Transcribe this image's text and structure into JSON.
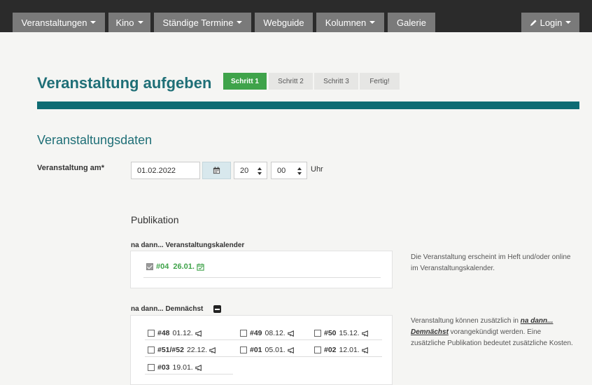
{
  "nav": {
    "items": [
      {
        "label": "Veranstaltungen",
        "dropdown": true
      },
      {
        "label": "Kino",
        "dropdown": true
      },
      {
        "label": "Ständige Termine",
        "dropdown": true
      },
      {
        "label": "Webguide",
        "dropdown": false
      },
      {
        "label": "Kolumnen",
        "dropdown": true
      },
      {
        "label": "Galerie",
        "dropdown": false
      }
    ],
    "login": {
      "label": "Login",
      "icon": "pencil-icon"
    }
  },
  "page": {
    "title": "Veranstaltung aufgeben",
    "steps": [
      {
        "label": "Schritt 1",
        "active": true
      },
      {
        "label": "Schritt 2",
        "active": false
      },
      {
        "label": "Schritt 3",
        "active": false
      },
      {
        "label": "Fertig!",
        "active": false
      }
    ],
    "accent_color": "#0f6c73",
    "active_step_color": "#3fa34a"
  },
  "form": {
    "section_title": "Veranstaltungsdaten",
    "date_label": "Veranstaltung am*",
    "date_value": "01.02.2022",
    "hour_value": "20",
    "minute_value": "00",
    "time_suffix": "Uhr"
  },
  "publication": {
    "title": "Publikation",
    "kalender": {
      "title": "na dann... Veranstaltungskalender",
      "item": {
        "num": "#04",
        "date": "26.01.",
        "checked": true
      },
      "help": "Die Veranstaltung erscheint im Heft und/oder online im Veranstaltungskalender."
    },
    "demnaechst": {
      "title": "na dann... Demnächst",
      "items": [
        {
          "num": "#48",
          "date": "01.12.",
          "checked": false
        },
        {
          "num": "#49",
          "date": "08.12.",
          "checked": false
        },
        {
          "num": "#50",
          "date": "15.12.",
          "checked": false
        },
        {
          "num": "#51/#52",
          "date": "22.12.",
          "checked": false
        },
        {
          "num": "#01",
          "date": "05.01.",
          "checked": false
        },
        {
          "num": "#02",
          "date": "12.01.",
          "checked": false
        },
        {
          "num": "#03",
          "date": "19.01.",
          "checked": false
        }
      ],
      "help_pre": "Veranstaltung können zusätzlich in ",
      "help_em": "na dann... Demnächst",
      "help_post": " vorangekündigt werden. Eine zusätzliche Publikation bedeutet zusätzliche Kosten."
    }
  }
}
